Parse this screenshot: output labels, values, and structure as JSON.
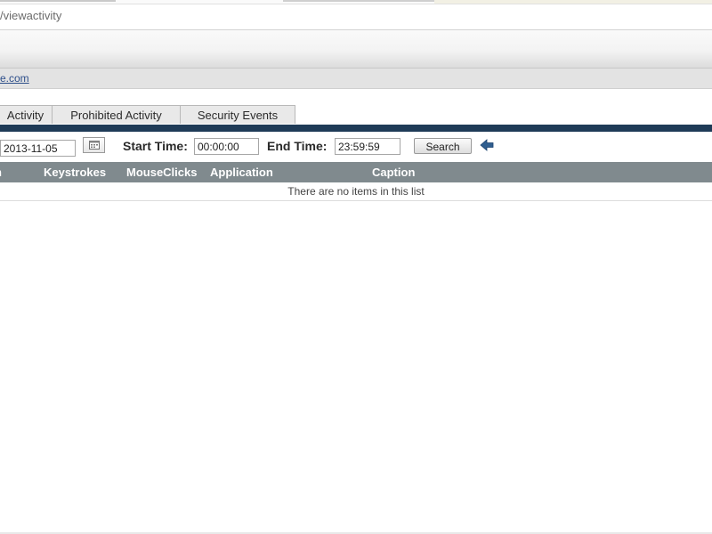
{
  "browser": {
    "url_text": "/viewactivity"
  },
  "domain_link": "e.com",
  "tabs": [
    {
      "label": "Activity"
    },
    {
      "label": "Prohibited Activity"
    },
    {
      "label": "Security Events"
    }
  ],
  "filters": {
    "date_value": "2013-11-05",
    "start_label": "Start Time:",
    "start_value": "00:00:00",
    "end_label": "End Time:",
    "end_value": "23:59:59",
    "search_label": "Search"
  },
  "table": {
    "columns": [
      "n",
      "Keystrokes",
      "MouseClicks",
      "Application",
      "Caption"
    ],
    "empty_message": "There are no items in this list"
  },
  "colors": {
    "nav_bar": "#1f3b57",
    "table_header": "#808a8e",
    "back_arrow": "#2f5e8f"
  },
  "icons": {
    "calendar": "calendar-icon",
    "back": "back-arrow-icon"
  }
}
